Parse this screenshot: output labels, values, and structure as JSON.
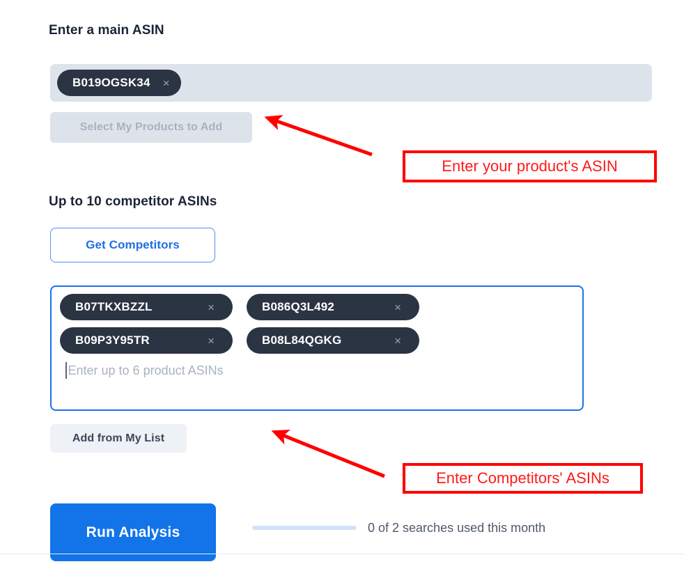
{
  "main_asin_section": {
    "heading": "Enter a main ASIN",
    "chips": [
      {
        "label": "B019OGSK34",
        "remove_icon": "close-icon",
        "remove_glyph": "×"
      }
    ],
    "select_products_button": "Select My Products to Add"
  },
  "competitor_section": {
    "heading": "Up to 10 competitor ASINs",
    "get_competitors_button": "Get Competitors",
    "chips": [
      {
        "label": "B07TKXBZZL",
        "remove_icon": "close-icon",
        "remove_glyph": "×"
      },
      {
        "label": "B086Q3L492",
        "remove_icon": "close-icon",
        "remove_glyph": "×"
      },
      {
        "label": "B09P3Y95TR",
        "remove_icon": "close-icon",
        "remove_glyph": "×"
      },
      {
        "label": "B08L84QGKG",
        "remove_icon": "close-icon",
        "remove_glyph": "×"
      }
    ],
    "asin_input": {
      "value": "",
      "placeholder": "Enter up to 6 product ASINs"
    },
    "add_from_list_button": "Add from My List"
  },
  "footer": {
    "run_analysis_button": "Run Analysis",
    "usage_text": "0 of 2 searches used this month",
    "usage_used": 0,
    "usage_total": 2,
    "usage_fill_percent": 0
  },
  "annotations": [
    {
      "text": "Enter your product's ASIN",
      "color": "#ff0000"
    },
    {
      "text": "Enter Competitors' ASINs",
      "color": "#ff0000"
    }
  ],
  "colors": {
    "primary_blue": "#1274e8",
    "chip_dark": "#2b3443",
    "field_gray": "#dde3ea",
    "annotation_red": "#ff0000",
    "usage_track": "#cfe4fb"
  }
}
